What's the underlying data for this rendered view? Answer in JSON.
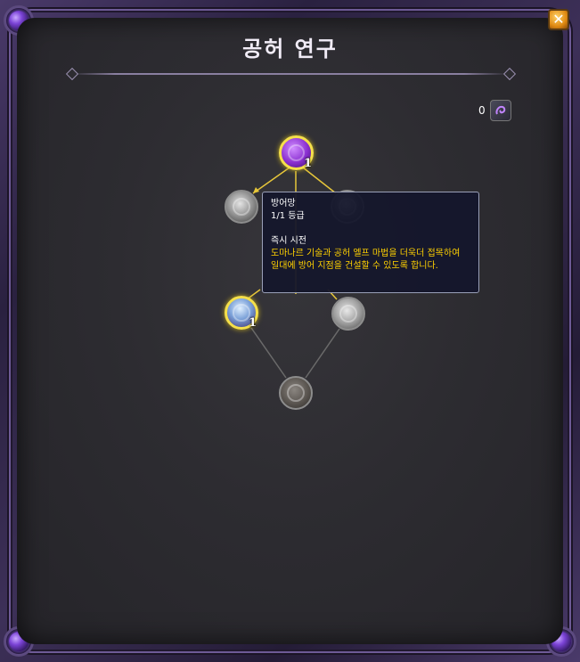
{
  "window": {
    "title": "공허 연구",
    "close_label": "✕"
  },
  "currency": {
    "count": "0",
    "icon": "void-research-currency-icon"
  },
  "talent_tree": {
    "nodes": [
      {
        "id": "void-top",
        "rank": "1",
        "state": "active"
      },
      {
        "id": "left-second",
        "rank": "",
        "state": "inactive"
      },
      {
        "id": "right-second",
        "rank": "",
        "state": "inactive"
      },
      {
        "id": "armor-shield",
        "rank": "1",
        "state": "active"
      },
      {
        "id": "right-third",
        "rank": "",
        "state": "inactive"
      },
      {
        "id": "bottom",
        "rank": "",
        "state": "locked"
      }
    ],
    "link_colors": {
      "active": "#e6c63a",
      "inactive": "#6a6a6a"
    }
  },
  "tooltip": {
    "name": "방어망",
    "rank": "1/1 등급",
    "cast": "즉시 시전",
    "description": "도마나르 기술과 공허 엘프 마법을 더욱더 접목하여 일대에 방어 지점을 건설할 수 있도록 합니다."
  },
  "colors": {
    "frame": "#4a3a6a",
    "panel": "#2d2c31",
    "tooltip_text_yellow": "#ffd100",
    "active_ring": "#f5e04a"
  }
}
